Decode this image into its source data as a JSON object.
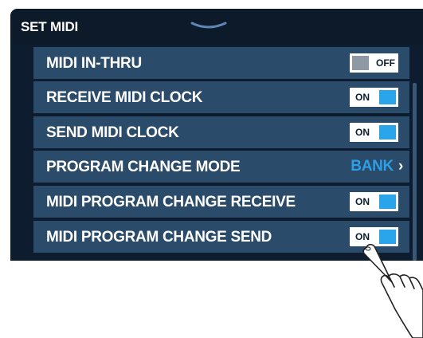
{
  "header": {
    "title": "SET MIDI",
    "handle_icon": "chevron-down-icon"
  },
  "rows": [
    {
      "label": "MIDI IN-THRU",
      "control": "toggle",
      "state": "OFF"
    },
    {
      "label": "RECEIVE MIDI CLOCK",
      "control": "toggle",
      "state": "ON"
    },
    {
      "label": "SEND MIDI CLOCK",
      "control": "toggle",
      "state": "ON"
    },
    {
      "label": "PROGRAM CHANGE MODE",
      "control": "value",
      "value": "BANK",
      "icon": "chevron-right-icon"
    },
    {
      "label": "MIDI PROGRAM CHANGE RECEIVE",
      "control": "toggle",
      "state": "ON"
    },
    {
      "label": "MIDI PROGRAM CHANGE SEND",
      "control": "toggle",
      "state": "ON"
    }
  ],
  "colors": {
    "background": "#0d1c2e",
    "row": "#2b4b6b",
    "accent": "#2aa5ec",
    "toggle_off_knob": "#8f99a4",
    "bank_value": "#2d9fe6"
  },
  "decorations": {
    "pointer": "tapping-hand-icon"
  }
}
